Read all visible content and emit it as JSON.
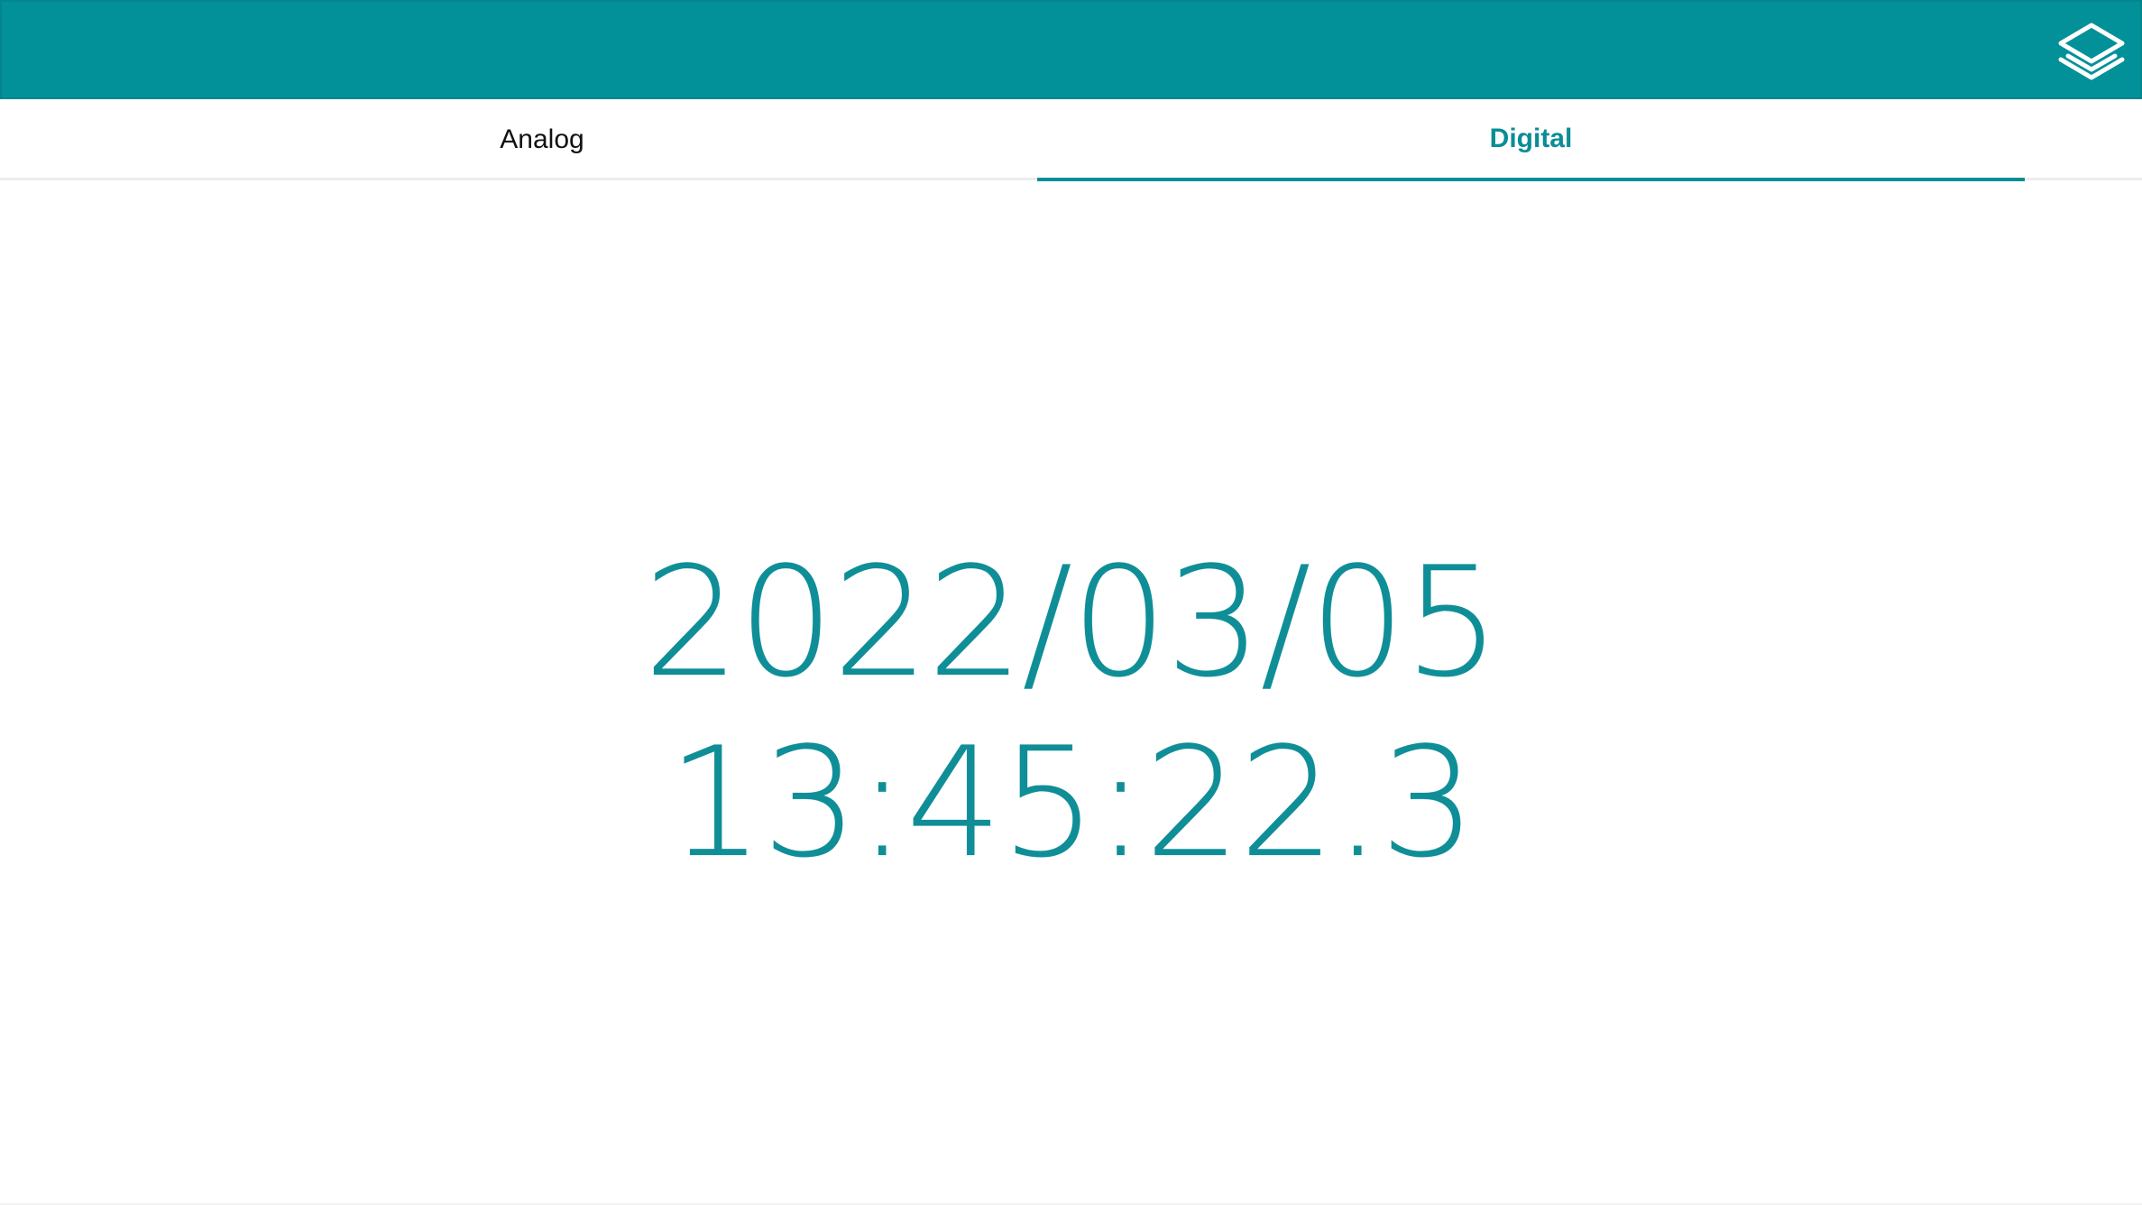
{
  "header": {
    "background_color": "#039199",
    "layers_icon": "layers-icon"
  },
  "tabs": [
    {
      "label": "Analog",
      "active": false
    },
    {
      "label": "Digital",
      "active": true
    }
  ],
  "accent_color": "#0a8d96",
  "clock": {
    "date": "2022/03/05",
    "time": "13:45:22.3"
  }
}
